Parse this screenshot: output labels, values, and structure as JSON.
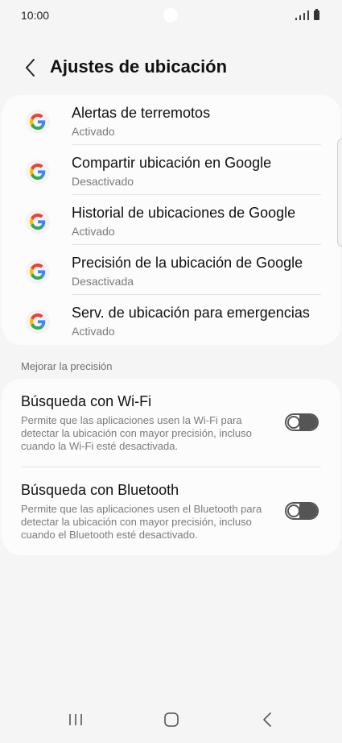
{
  "status": {
    "time": "10:00"
  },
  "header": {
    "title": "Ajustes de ubicación"
  },
  "google_services": [
    {
      "title": "Alertas de terremotos",
      "status": "Activado"
    },
    {
      "title": "Compartir ubicación en Google",
      "status": "Desactivado"
    },
    {
      "title": "Historial de ubicaciones de Google",
      "status": "Activado"
    },
    {
      "title": "Precisión de la ubicación de Google",
      "status": "Desactivada"
    },
    {
      "title": "Serv. de ubicación para emergencias",
      "status": "Activado"
    }
  ],
  "improve_section": {
    "label": "Mejorar la precisión",
    "items": [
      {
        "title": "Búsqueda con Wi-Fi",
        "description": "Permite que las aplicaciones usen la Wi-Fi para detectar la ubicación con mayor precisión, incluso cuando la Wi-Fi esté desactivada.",
        "enabled": false
      },
      {
        "title": "Búsqueda con Bluetooth",
        "description": "Permite que las aplicaciones usen el Bluetooth para detectar la ubicación con mayor precisión, incluso cuando el Bluetooth esté desactivado.",
        "enabled": false
      }
    ]
  },
  "icons": {
    "back": "chevron-left-icon",
    "google": "google-g-icon",
    "nav_recents": "recents-icon",
    "nav_home": "home-icon",
    "nav_back": "back-icon"
  },
  "colors": {
    "background": "#f5f5f6",
    "card": "#fcfcfc",
    "secondary_text": "#7b7b7b",
    "google_blue": "#4285F4",
    "google_red": "#EA4335",
    "google_yellow": "#FBBC05",
    "google_green": "#34A853"
  }
}
